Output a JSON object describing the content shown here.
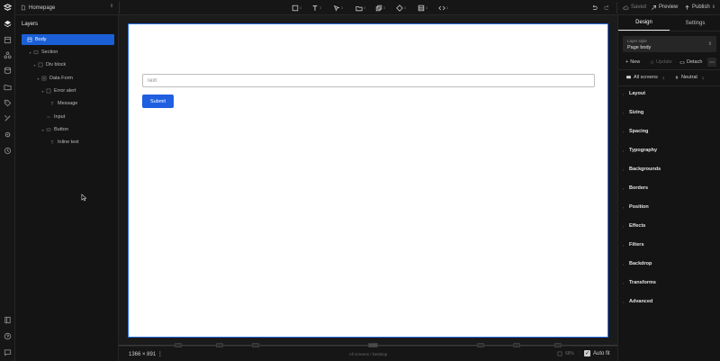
{
  "topbar": {
    "page_name": "Homepage",
    "page_chevron": "⇕",
    "tools": [
      {
        "icon": "frame-icon",
        "count": "3"
      },
      {
        "icon": "text-tool-icon",
        "count": "3"
      },
      {
        "icon": "cursor-tool-icon",
        "count": "3"
      },
      {
        "icon": "folder-icon",
        "count": "3"
      },
      {
        "icon": "shapes-icon",
        "count": "3"
      },
      {
        "icon": "components-icon",
        "count": "3"
      },
      {
        "icon": "cms-icon",
        "count": "3"
      },
      {
        "icon": "code-icon",
        "count": "3"
      }
    ],
    "saved_label": "Saved",
    "preview_label": "Preview",
    "publish_label": "Publish",
    "publish_chevron": "⇕"
  },
  "layers": {
    "title": "Layers",
    "items": [
      {
        "label": "Body",
        "depth": 0,
        "selected": true
      },
      {
        "label": "Section",
        "depth": 1,
        "selected": false
      },
      {
        "label": "Div block",
        "depth": 2,
        "selected": false
      },
      {
        "label": "Data Form",
        "depth": 3,
        "selected": false
      },
      {
        "label": "Error alert",
        "depth": 4,
        "selected": false
      },
      {
        "label": "Message",
        "depth": 5,
        "selected": false
      },
      {
        "label": "Input",
        "depth": 4,
        "selected": false
      },
      {
        "label": "Button",
        "depth": 4,
        "selected": false
      },
      {
        "label": "Inline text",
        "depth": 5,
        "selected": false
      }
    ]
  },
  "canvas": {
    "input_placeholder": "Text",
    "submit_label": "Submit"
  },
  "bottombar": {
    "dimensions": "1366 × 891 ⋮",
    "breakpoint_label": "All screens / Desktop",
    "zoom": "68%",
    "zoom_chevron": "⋮",
    "autofit_label": "Auto fit",
    "autofit_checked": true
  },
  "right_panel": {
    "tabs": [
      "Design",
      "Settings"
    ],
    "active_tab": "Design",
    "layer_style_label": "Layer style",
    "layer_style_value": "Page body",
    "style_chevron": "⇕",
    "new_label": "New",
    "update_label": "Update",
    "detach_label": "Detach",
    "more_label": "⋯",
    "scope_screens": "All screens",
    "scope_screens_count": "1",
    "scope_state": "Neutral",
    "scope_state_count": "1",
    "sections": [
      "Layout",
      "Sizing",
      "Spacing",
      "Typography",
      "Backgrounds",
      "Borders",
      "Position",
      "Effects",
      "Filters",
      "Backdrop",
      "Transforms",
      "Advanced"
    ]
  },
  "colors": {
    "accent": "#1f5fe0",
    "selection": "#1a5fd6",
    "panel_bg": "#141414"
  }
}
